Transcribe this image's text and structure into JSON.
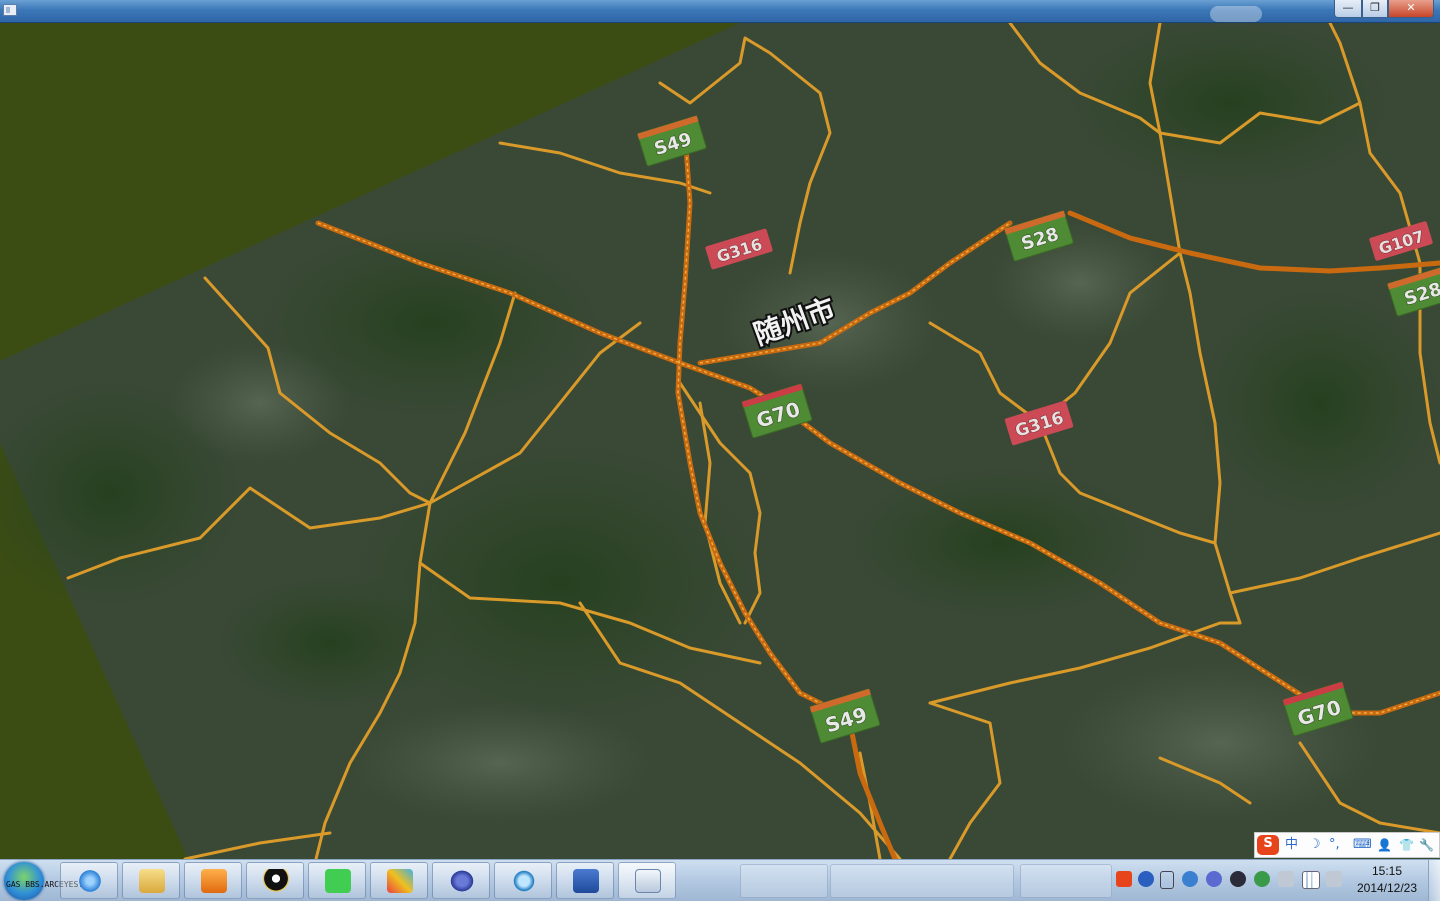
{
  "window": {
    "minimize_glyph": "—",
    "maximize_glyph": "❐",
    "close_glyph": "✕"
  },
  "map": {
    "city_label": "随州市",
    "road_labels": [
      "S49",
      "G316",
      "S28",
      "G107",
      "S28",
      "G70",
      "G316",
      "S49",
      "G70"
    ],
    "colors": {
      "background": "#3c4d13",
      "terrain": "#3a4a34",
      "road": "#d99a2a",
      "expressway": "#c96a10",
      "national_shield": "#cc4a55",
      "provincial_shield": "#4f8a34"
    }
  },
  "ime": {
    "logo": "S",
    "mode": "中",
    "icons": [
      "moon-icon",
      "punctuation-icon",
      "keyboard-icon",
      "user-icon",
      "shirt-icon",
      "wrench-icon"
    ],
    "moon": "☽",
    "punct": "°,",
    "kbd": "⌨",
    "user": "👤",
    "shirt": "👕",
    "wrench": "🔧"
  },
  "taskbar": {
    "start_overlay_text": "BBS.ARCEYES.COM",
    "start_side_text": "GAS",
    "apps": [
      "internet-explorer",
      "file-explorer",
      "media-player",
      "qq",
      "qt-creator",
      "visual-app",
      "infinity-app",
      "search-app",
      "word",
      "active-window"
    ],
    "clock_time": "15:15",
    "clock_date": "2014/12/23"
  }
}
